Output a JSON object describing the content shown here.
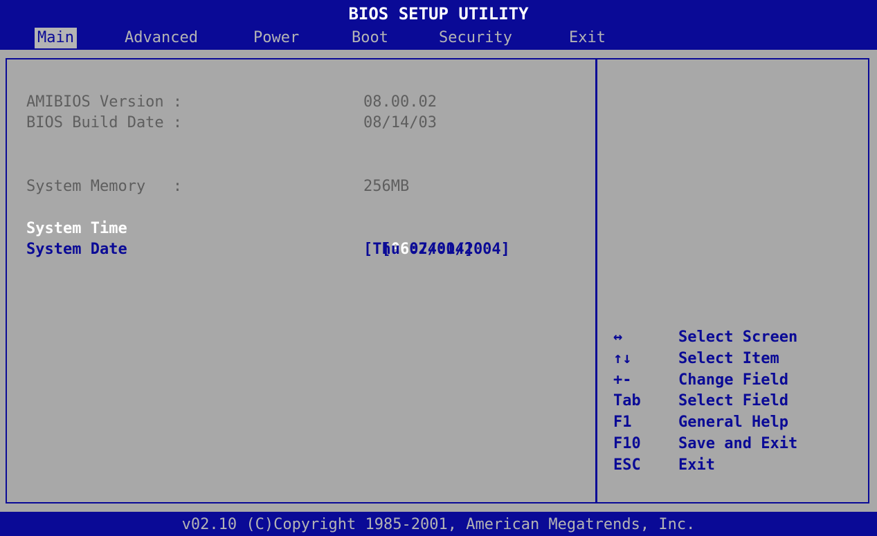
{
  "window": {
    "title": "BIOS SETUP UTILITY"
  },
  "tabs": [
    {
      "label": "Main",
      "active": true
    },
    {
      "label": "Advanced"
    },
    {
      "label": "Power"
    },
    {
      "label": "Boot"
    },
    {
      "label": "Security"
    },
    {
      "label": "Exit"
    }
  ],
  "info": [
    {
      "label": "AMIBIOS Version :",
      "value": "08.00.02"
    },
    {
      "label": "BIOS Build Date :",
      "value": "08/14/03"
    },
    {
      "label": "System Memory   :",
      "value": "256MB"
    }
  ],
  "settings": {
    "time": {
      "label": "System Time",
      "value_open": "[",
      "value_cursor": "06",
      "value_rest": ":24:04]"
    },
    "date": {
      "label": "System Date",
      "value": "[Thu 07/01/2004]"
    }
  },
  "help": [
    {
      "key": "↔",
      "desc": "Select Screen"
    },
    {
      "key": "↑↓",
      "desc": "Select Item"
    },
    {
      "key": "+-",
      "desc": "Change Field"
    },
    {
      "key": "Tab",
      "desc": "Select Field"
    },
    {
      "key": "F1",
      "desc": "General Help"
    },
    {
      "key": "F10",
      "desc": "Save and Exit"
    },
    {
      "key": "ESC",
      "desc": "Exit"
    }
  ],
  "footer": {
    "copyright": "v02.10 (C)Copyright 1985-2001, American Megatrends, Inc."
  },
  "colors": {
    "background": "#a8a8a8",
    "accent_blue": "#0a0a96",
    "dim_text": "#5e5e5e",
    "highlight": "#ffffff"
  }
}
